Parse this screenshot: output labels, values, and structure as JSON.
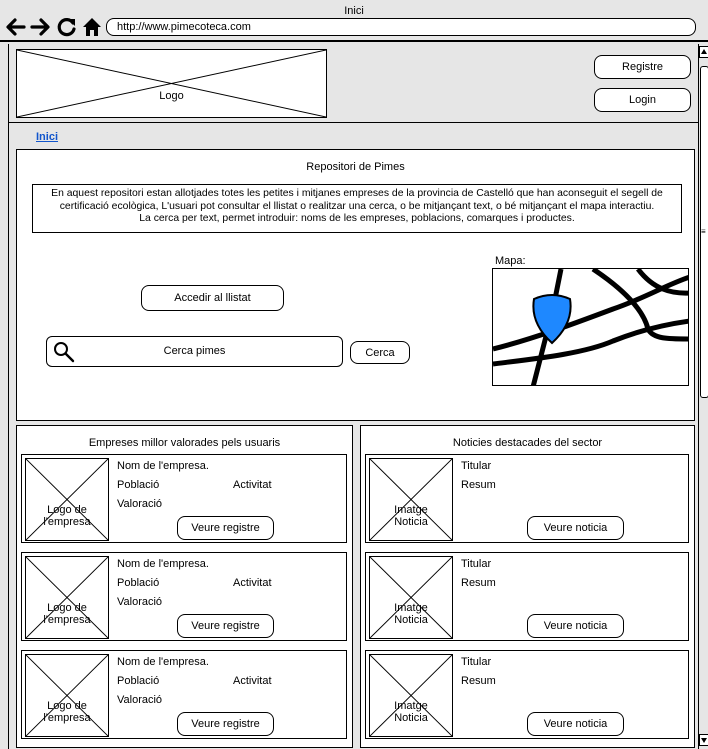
{
  "window": {
    "title": "Inici"
  },
  "browser": {
    "url": "http://www.pimecoteca.com"
  },
  "header": {
    "logo_label": "Logo",
    "register_label": "Registre",
    "login_label": "Login"
  },
  "breadcrumb": {
    "home": "Inici"
  },
  "repository": {
    "title": "Repositori de Pimes",
    "description_lines": [
      "En aquest repositori estan allotjades totes les petites i mitjanes empreses de la provincia de Castelló que han aconseguit el segell de",
      "certificació ecològica, L'usuari pot consultar el llistat o realitzar una cerca, o be mitjançant text, o bé mitjançant el mapa interactiu.",
      "La cerca per text, permet introduir: noms de les empreses, poblacions, comarques i productes."
    ],
    "list_button": "Accedir al llistat",
    "search_placeholder": "Cerca pimes",
    "search_button": "Cerca",
    "map_label": "Mapa:"
  },
  "companies": {
    "title": "Empreses millor valorades pels usuaris",
    "items": [
      {
        "logo_label": "Logo de l'empresa",
        "name": "Nom de l'empresa.",
        "town": "Població",
        "activity": "Activitat",
        "rating": "Valoració",
        "button": "Veure registre"
      },
      {
        "logo_label": "Logo de l'empresa",
        "name": "Nom de l'empresa.",
        "town": "Població",
        "activity": "Activitat",
        "rating": "Valoració",
        "button": "Veure registre"
      },
      {
        "logo_label": "Logo de l'empresa",
        "name": "Nom de l'empresa.",
        "town": "Població",
        "activity": "Activitat",
        "rating": "Valoració",
        "button": "Veure registre"
      }
    ]
  },
  "news": {
    "title": "Noticies destacades del sector",
    "items": [
      {
        "image_label": "Imatge Noticia",
        "headline": "Titular",
        "summary": "Resum",
        "button": "Veure noticia"
      },
      {
        "image_label": "Imatge Noticia",
        "headline": "Titular",
        "summary": "Resum",
        "button": "Veure noticia"
      },
      {
        "image_label": "Imatge Noticia",
        "headline": "Titular",
        "summary": "Resum",
        "button": "Veure noticia"
      }
    ]
  },
  "icons": {
    "back": "arrow-left-icon",
    "forward": "arrow-right-icon",
    "reload": "reload-icon",
    "home": "home-icon",
    "search": "magnifier-icon",
    "map_marker": "shield-marker-icon"
  },
  "colors": {
    "link": "#1155cc",
    "marker": "#1e88ff",
    "chrome": "#e6e6e6"
  }
}
